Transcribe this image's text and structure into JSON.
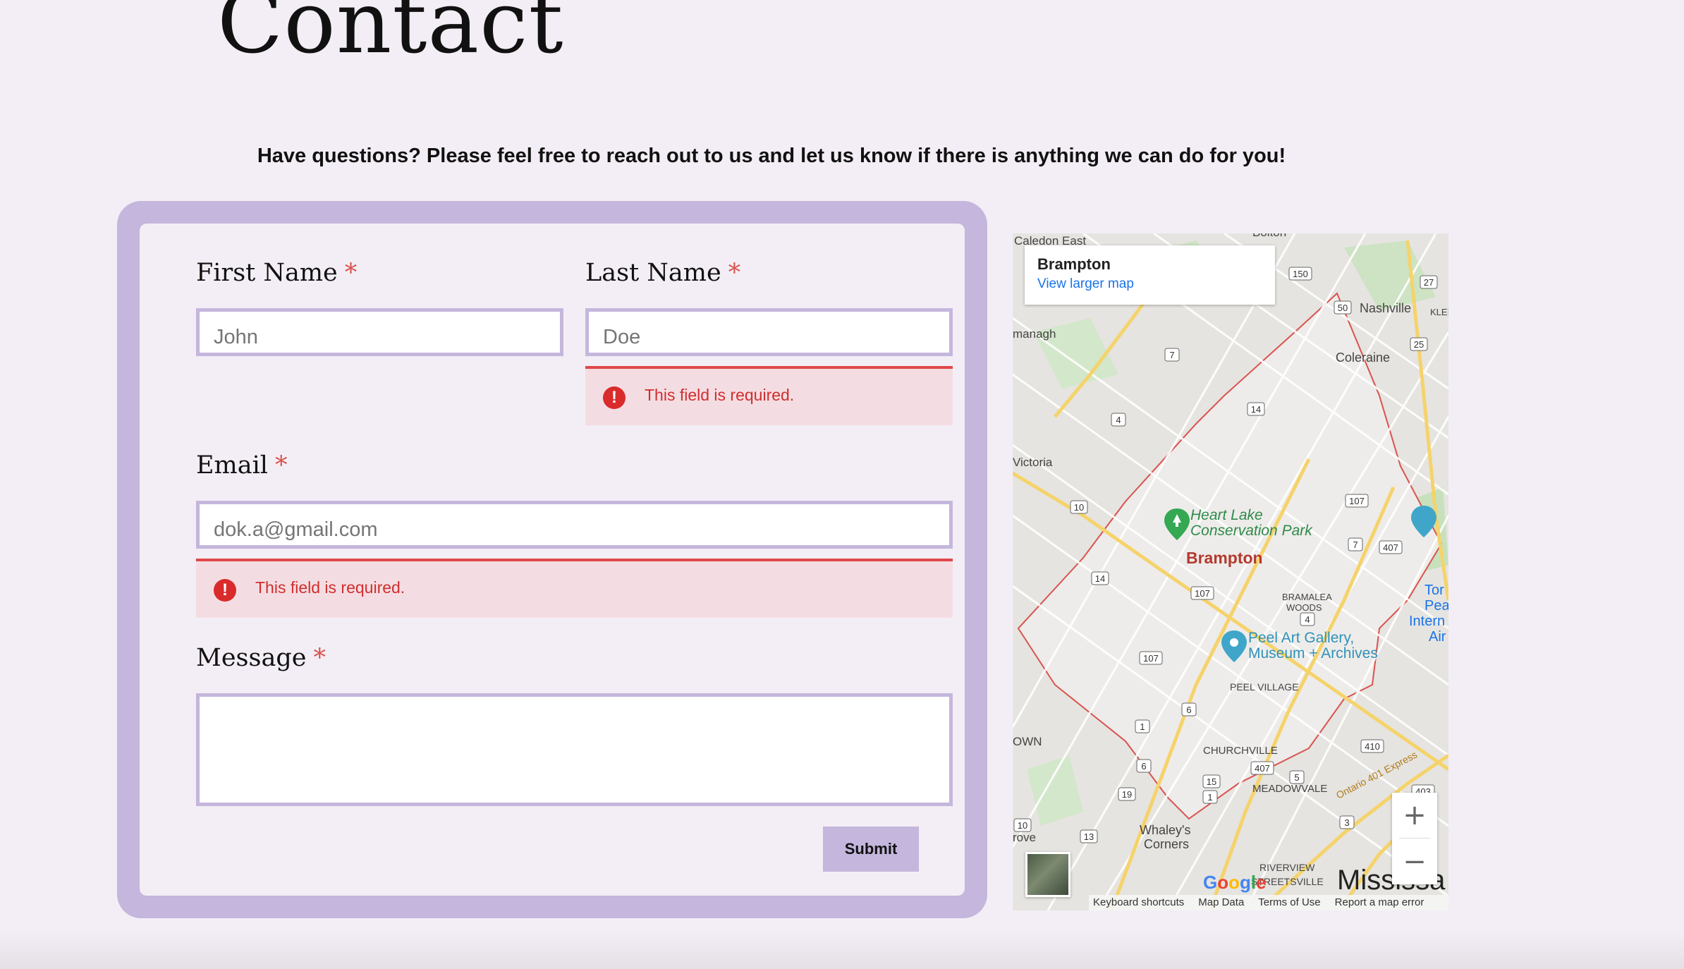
{
  "page": {
    "title": "Contact",
    "intro": "Have questions? Please feel free to reach out to us and let us know if there is anything we can do for you!"
  },
  "form": {
    "required_mark": "*",
    "first_name": {
      "label": "First Name",
      "placeholder": "John",
      "value": ""
    },
    "last_name": {
      "label": "Last Name",
      "placeholder": "Doe",
      "value": "",
      "error": "This field is required."
    },
    "email": {
      "label": "Email",
      "placeholder": "dok.a@gmail.com",
      "value": "",
      "error": "This field is required."
    },
    "message": {
      "label": "Message",
      "value": ""
    },
    "error_icon": "!",
    "submit_label": "Submit"
  },
  "map": {
    "place_name": "Brampton",
    "larger_map_link": "View larger map",
    "city_label": "Brampton",
    "park_label_1": "Heart Lake",
    "park_label_2": "Conservation Park",
    "gallery_label_1": "Peel Art Gallery,",
    "gallery_label_2": "Museum + Archives",
    "places": {
      "caledon": "Caledon East",
      "bolton": "Bolton",
      "nashville": "Nashville",
      "kleinburg": "KLEI",
      "coleraine": "Coleraine",
      "managh": "managh",
      "victoria": "Victoria",
      "bramalea_woods_1": "BRAMALEA",
      "bramalea_woods_2": "WOODS",
      "peel_village": "PEEL VILLAGE",
      "churchville": "CHURCHVILLE",
      "meadowvale": "MEADOWVALE",
      "whaleys_1": "Whaley's",
      "whaleys_2": "Corners",
      "riverview": "RIVERVIEW",
      "streetsville": "STREETSVILLE",
      "mississauga": "Mississa",
      "town": "OWN",
      "grove": "rove",
      "toronto_1": "Tor",
      "toronto_2": "Pea",
      "toronto_3": "Intern",
      "toronto_4": "Air",
      "highway_401": "Ontario 401 Express"
    },
    "routes": [
      "150",
      "27",
      "50",
      "25",
      "7",
      "4",
      "14",
      "10",
      "107",
      "407",
      "7",
      "14",
      "107",
      "4",
      "107",
      "6",
      "1",
      "410",
      "407",
      "5",
      "6",
      "15",
      "1",
      "19",
      "10",
      "13",
      "3",
      "403"
    ],
    "zoom_in": "+",
    "zoom_out": "−",
    "google_logo": "Google",
    "footer_links": [
      "Keyboard shortcuts",
      "Map Data",
      "Terms of Use",
      "Report a map error"
    ]
  },
  "colors": {
    "background": "#f3eef5",
    "form_frame": "#c4b6dc",
    "error_bg": "#f4dde2",
    "error_text": "#d02e2e",
    "required": "#d9534f"
  }
}
